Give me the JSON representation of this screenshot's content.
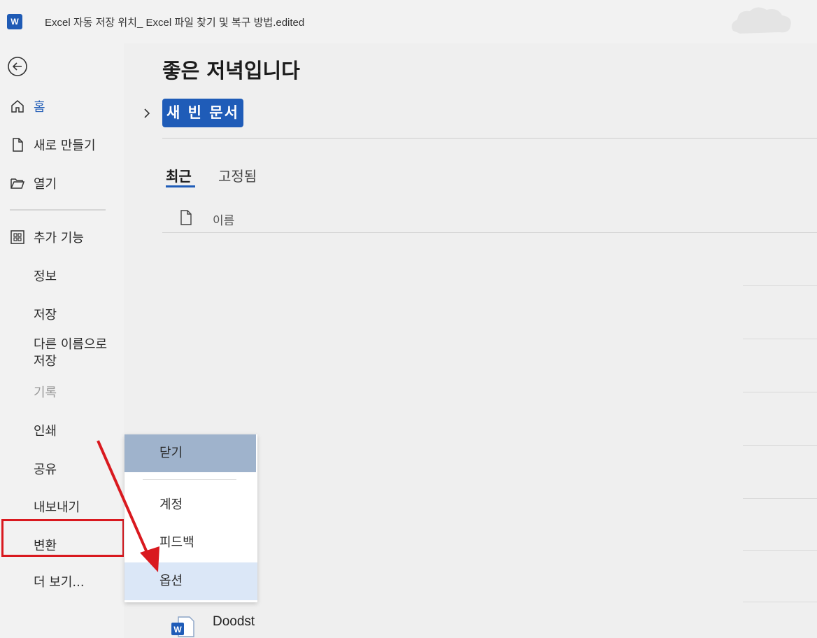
{
  "window": {
    "title": "Excel 자동 저장 위치_ Excel 파일 찾기 및 복구 방법.edited",
    "app_icon_letter": "W",
    "accent_color": "#1f5cb8"
  },
  "nav": {
    "items": [
      {
        "label": "홈",
        "icon": "home-icon",
        "active": true
      },
      {
        "label": "새로 만들기",
        "icon": "new-document-icon"
      },
      {
        "label": "열기",
        "icon": "open-folder-icon"
      },
      {
        "label": "추가 기능",
        "icon": "add-ins-grid-icon"
      },
      {
        "label": "정보"
      },
      {
        "label": "저장"
      },
      {
        "label": "다른 이름으로 저장",
        "lines": [
          "다른 이름으로",
          "저장"
        ]
      },
      {
        "label": "기록",
        "disabled": true
      },
      {
        "label": "인쇄"
      },
      {
        "label": "공유"
      },
      {
        "label": "내보내기"
      },
      {
        "label": "변환"
      },
      {
        "label": "더 보기..."
      }
    ]
  },
  "main": {
    "greeting": "좋은 저녁입니다",
    "new_blank_document": "새 빈 문서",
    "tabs": [
      {
        "label": "최근",
        "selected": true
      },
      {
        "label": "고정됨"
      }
    ],
    "list_header": {
      "name_column": "이름"
    },
    "files": [
      {
        "name": "Doodst",
        "icon": "word-document-icon"
      }
    ]
  },
  "more_menu": {
    "items": [
      {
        "label": "닫기"
      },
      {
        "label": "계정"
      },
      {
        "label": "피드백"
      },
      {
        "label": "옵션",
        "highlighted": true
      }
    ]
  },
  "annotation": {
    "highlight_color": "#d9191f"
  }
}
